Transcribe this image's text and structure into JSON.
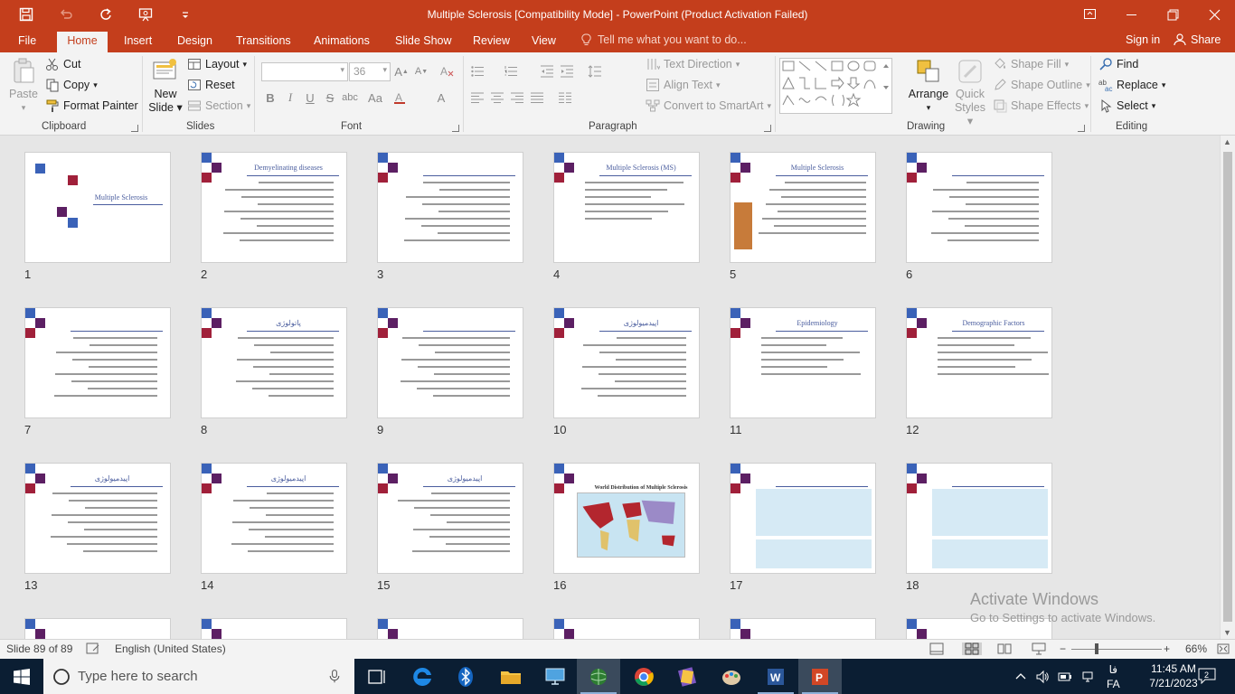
{
  "window": {
    "title": "Multiple Sclerosis [Compatibility Mode] - PowerPoint (Product Activation Failed)",
    "accent": "#c43e1c"
  },
  "tabs": [
    "File",
    "Home",
    "Insert",
    "Design",
    "Transitions",
    "Animations",
    "Slide Show",
    "Review",
    "View"
  ],
  "active_tab": "Home",
  "tell_me": "Tell me what you want to do...",
  "sign_in": "Sign in",
  "share": "Share",
  "ribbon": {
    "clipboard": {
      "label": "Clipboard",
      "paste": "Paste",
      "cut": "Cut",
      "copy": "Copy",
      "format_painter": "Format Painter"
    },
    "slides": {
      "label": "Slides",
      "new_slide_1": "New",
      "new_slide_2": "Slide",
      "layout": "Layout",
      "reset": "Reset",
      "section": "Section"
    },
    "font": {
      "label": "Font",
      "size": "36",
      "bold": "B",
      "italic": "I",
      "underline": "U",
      "strike": "S"
    },
    "paragraph": {
      "label": "Paragraph",
      "text_direction": "Text Direction",
      "align_text": "Align Text",
      "convert_smartart": "Convert to SmartArt"
    },
    "drawing": {
      "label": "Drawing",
      "arrange": "Arrange",
      "quick_styles_1": "Quick",
      "quick_styles_2": "Styles",
      "shape_fill": "Shape Fill",
      "shape_outline": "Shape Outline",
      "shape_effects": "Shape Effects"
    },
    "editing": {
      "label": "Editing",
      "find": "Find",
      "replace": "Replace",
      "select": "Select"
    }
  },
  "slides": [
    {
      "num": "1",
      "title": "Multiple Sclerosis",
      "kind": "title"
    },
    {
      "num": "2",
      "title": "Demyelinating diseases",
      "kind": "text"
    },
    {
      "num": "3",
      "title": "",
      "kind": "text"
    },
    {
      "num": "4",
      "title": "Multiple Sclerosis (MS)",
      "kind": "list"
    },
    {
      "num": "5",
      "title": "Multiple Sclerosis",
      "kind": "figure"
    },
    {
      "num": "6",
      "title": "",
      "kind": "text"
    },
    {
      "num": "7",
      "title": "",
      "kind": "text"
    },
    {
      "num": "8",
      "title": "پاتولوژی",
      "kind": "text"
    },
    {
      "num": "9",
      "title": "",
      "kind": "text"
    },
    {
      "num": "10",
      "title": "اپیدمیولوژی",
      "kind": "text"
    },
    {
      "num": "11",
      "title": "Epidemiology",
      "kind": "list"
    },
    {
      "num": "12",
      "title": "Demographic Factors",
      "kind": "list"
    },
    {
      "num": "13",
      "title": "اپیدمیولوژی",
      "kind": "text"
    },
    {
      "num": "14",
      "title": "اپیدمیولوژی",
      "kind": "text"
    },
    {
      "num": "15",
      "title": "اپیدمیولوژی",
      "kind": "text"
    },
    {
      "num": "16",
      "title": "World Distribution of Multiple Sclerosis",
      "kind": "map"
    },
    {
      "num": "17",
      "title": "",
      "kind": "boxes"
    },
    {
      "num": "18",
      "title": "",
      "kind": "boxes"
    }
  ],
  "activation": {
    "line1": "Activate Windows",
    "line2": "Go to Settings to activate Windows."
  },
  "status": {
    "slide_count": "Slide 89 of 89",
    "language": "English (United States)",
    "zoom": "66%"
  },
  "taskbar": {
    "search_placeholder": "Type here to search",
    "lang_fa": "فا",
    "lang_code": "FA",
    "time": "11:45 AM",
    "date": "7/21/2023",
    "notifications": "2"
  }
}
